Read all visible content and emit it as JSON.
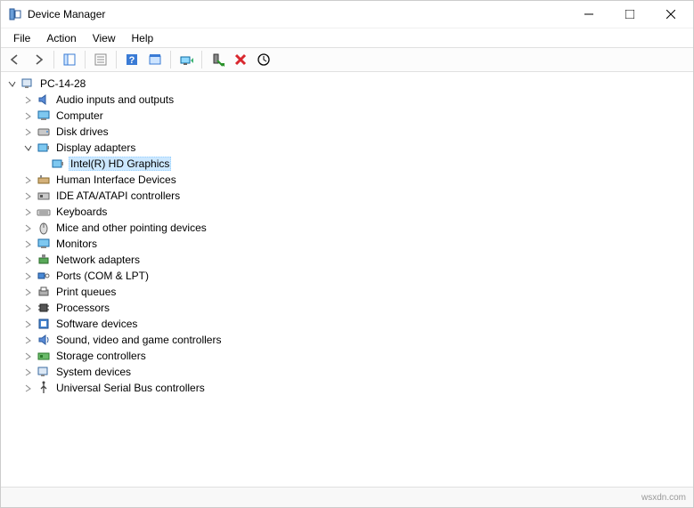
{
  "window": {
    "title": "Device Manager"
  },
  "menu": {
    "file": "File",
    "action": "Action",
    "view": "View",
    "help": "Help"
  },
  "tree": {
    "root": "PC-14-28",
    "audio": "Audio inputs and outputs",
    "computer": "Computer",
    "disk": "Disk drives",
    "display": "Display adapters",
    "intel": "Intel(R) HD Graphics",
    "hid": "Human Interface Devices",
    "ide": "IDE ATA/ATAPI controllers",
    "keyboards": "Keyboards",
    "mice": "Mice and other pointing devices",
    "monitors": "Monitors",
    "network": "Network adapters",
    "ports": "Ports (COM & LPT)",
    "printq": "Print queues",
    "processors": "Processors",
    "software": "Software devices",
    "sound": "Sound, video and game controllers",
    "storage": "Storage controllers",
    "system": "System devices",
    "usb": "Universal Serial Bus controllers"
  },
  "status": {
    "watermark": "wsxdn.com"
  }
}
